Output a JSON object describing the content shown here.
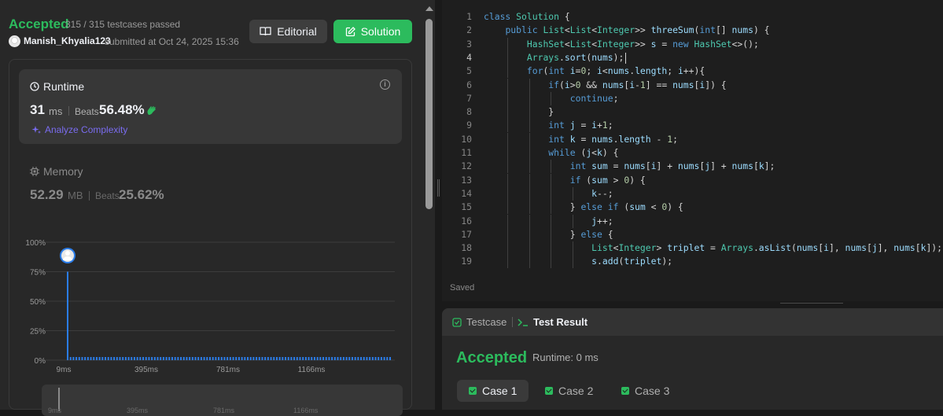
{
  "submission": {
    "status": "Accepted",
    "passed": "315 / 315 testcases passed",
    "username": "Manish_Khyalia123",
    "submitted_at": "submitted at Oct 24, 2025 15:36"
  },
  "buttons": {
    "editorial": "Editorial",
    "solution": "Solution"
  },
  "runtime": {
    "title": "Runtime",
    "value": "31",
    "unit": "ms",
    "beats_label": "Beats",
    "beats_value": "56.48%",
    "analyze": "Analyze Complexity"
  },
  "memory": {
    "title": "Memory",
    "value": "52.29",
    "unit": "MB",
    "beats_label": "Beats",
    "beats_value": "25.62%"
  },
  "chart_data": {
    "type": "bar",
    "x_labels": [
      "9ms",
      "395ms",
      "781ms",
      "1166ms"
    ],
    "y_labels": [
      "100%",
      "75%",
      "50%",
      "25%",
      "0%"
    ],
    "highlight_bar_value_pct": 75,
    "bar_count": 112,
    "ylim": [
      0,
      100
    ],
    "grid": true,
    "accent": "#2b7de9"
  },
  "brush_labels": [
    "9ms",
    "395ms",
    "781ms",
    "1166ms"
  ],
  "editor": {
    "lines": [
      {
        "n": "1",
        "code": "class Solution {"
      },
      {
        "n": "2",
        "code": "    public List<List<Integer>> threeSum(int[] nums) {"
      },
      {
        "n": "3",
        "code": "        HashSet<List<Integer>> s = new HashSet<>();"
      },
      {
        "n": "4",
        "code": "        Arrays.sort(nums);"
      },
      {
        "n": "5",
        "code": "        for(int i=0; i<nums.length; i++){"
      },
      {
        "n": "6",
        "code": "            if(i>0 && nums[i-1] == nums[i]) {"
      },
      {
        "n": "7",
        "code": "                continue;"
      },
      {
        "n": "8",
        "code": "            }"
      },
      {
        "n": "9",
        "code": "            int j = i+1;"
      },
      {
        "n": "10",
        "code": "            int k = nums.length - 1;"
      },
      {
        "n": "11",
        "code": "            while (j<k) {"
      },
      {
        "n": "12",
        "code": "                int sum = nums[i] + nums[j] + nums[k];"
      },
      {
        "n": "13",
        "code": "                if (sum > 0) {"
      },
      {
        "n": "14",
        "code": "                    k--;"
      },
      {
        "n": "15",
        "code": "                } else if (sum < 0) {"
      },
      {
        "n": "16",
        "code": "                    j++;"
      },
      {
        "n": "17",
        "code": "                } else {"
      },
      {
        "n": "18",
        "code": "                    List<Integer> triplet = Arrays.asList(nums[i], nums[j], nums[k]);"
      },
      {
        "n": "19",
        "code": "                    s.add(triplet);"
      }
    ],
    "saved": "Saved"
  },
  "result_panel": {
    "tab_testcase": "Testcase",
    "tab_result": "Test Result",
    "status": "Accepted",
    "runtime": "Runtime: 0 ms",
    "cases": [
      "Case 1",
      "Case 2",
      "Case 3"
    ]
  }
}
